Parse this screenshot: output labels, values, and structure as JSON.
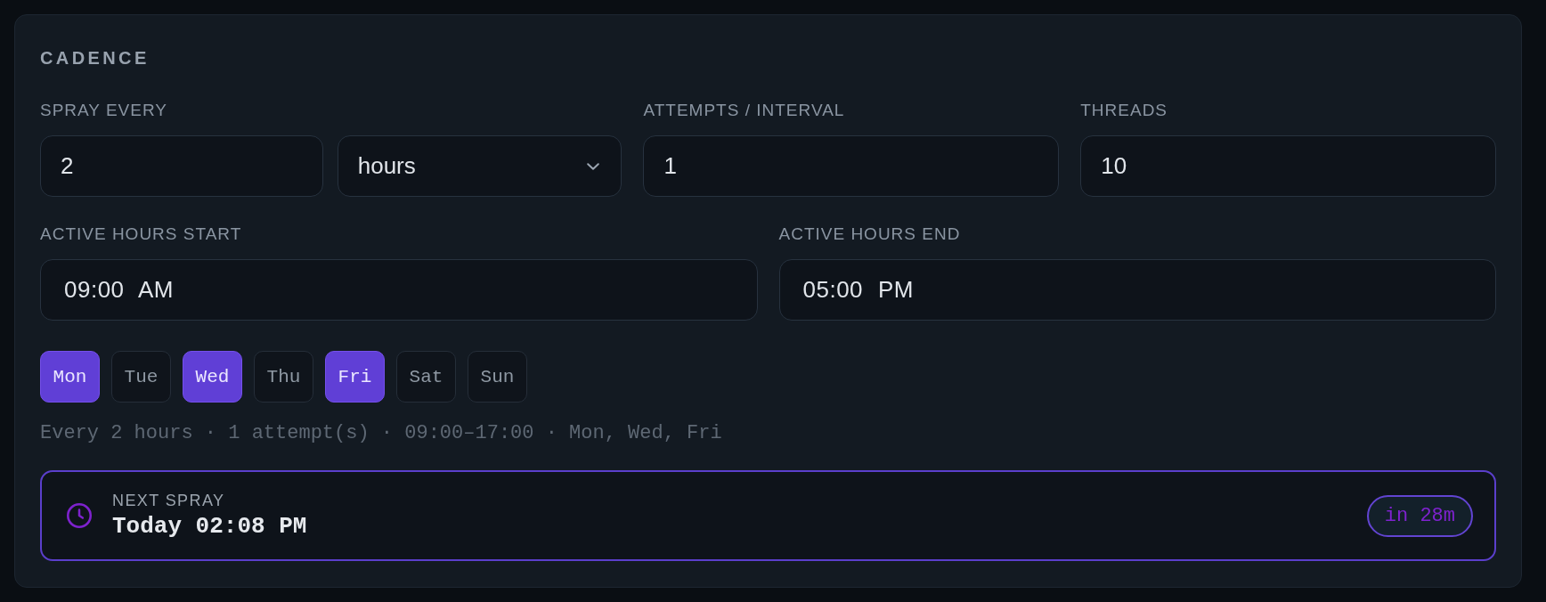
{
  "card": {
    "title": "CADENCE"
  },
  "interval_row": [
    {
      "label": "SPRAY EVERY",
      "controls": [
        {
          "kind": "number",
          "value": "2"
        },
        {
          "kind": "select",
          "value": "hours"
        }
      ]
    },
    {
      "label": "ATTEMPTS / INTERVAL",
      "controls": [
        {
          "kind": "number",
          "value": "1"
        }
      ]
    },
    {
      "label": "THREADS",
      "controls": [
        {
          "kind": "number",
          "value": "10"
        }
      ]
    }
  ],
  "hours_row": [
    {
      "label": "ACTIVE HOURS START",
      "value": "09:00 AM"
    },
    {
      "label": "ACTIVE HOURS END",
      "value": "05:00 PM"
    }
  ],
  "days": [
    {
      "label": "Mon",
      "selected": true
    },
    {
      "label": "Tue",
      "selected": false
    },
    {
      "label": "Wed",
      "selected": true
    },
    {
      "label": "Thu",
      "selected": false
    },
    {
      "label": "Fri",
      "selected": true
    },
    {
      "label": "Sat",
      "selected": false
    },
    {
      "label": "Sun",
      "selected": false
    }
  ],
  "summary": "Every 2 hours · 1 attempt(s) · 09:00–17:00 · Mon, Wed, Fri",
  "next_spray": {
    "label": "NEXT SPRAY",
    "time": "Today 02:08 PM",
    "countdown": "in 28m"
  }
}
